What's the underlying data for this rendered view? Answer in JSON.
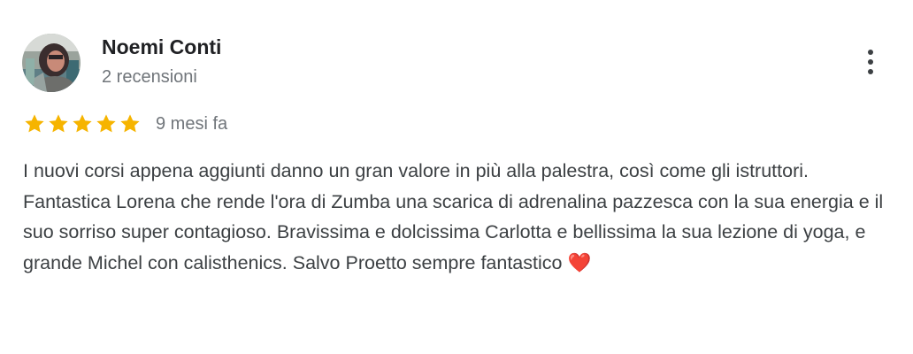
{
  "review": {
    "author_name": "Noemi Conti",
    "review_count": "2 recensioni",
    "rating": 5,
    "rating_max": 5,
    "date": "9 mesi fa",
    "text": "I nuovi corsi appena aggiunti danno un gran valore in più alla palestra, così come gli istruttori. Fantastica Lorena che rende l'ora di Zumba una scarica di adrenalina pazzesca con la sua energia e il suo sorriso super contagioso. Bravissima e dolcissima Carlotta e bellissima la sua lezione di yoga, e grande Michel con calisthenics. Salvo Proetto sempre fantastico",
    "emoji": "❤️",
    "icons": {
      "star": "star-icon",
      "menu": "more-vert-icon",
      "heart": "red-heart-emoji"
    }
  },
  "colors": {
    "star": "#f6b400",
    "name": "#202124",
    "secondary": "#70757a",
    "body_text": "#3c4043",
    "heart": "#e0243a"
  }
}
